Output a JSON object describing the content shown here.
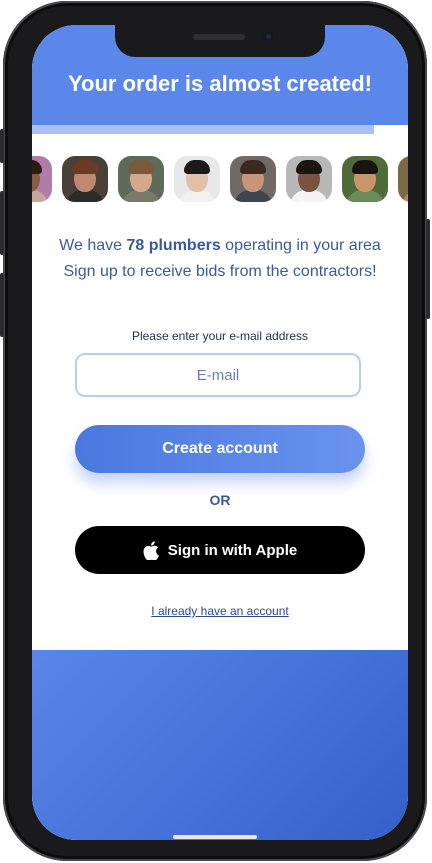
{
  "header": {
    "title": "Your order is almost created!"
  },
  "progress": {
    "fraction": 0.91
  },
  "contractors": [
    {
      "skin": "#8b5a42",
      "hair": "#2a1a12",
      "shirt": "#c7a79a",
      "bg": "#b07ca8"
    },
    {
      "skin": "#c08870",
      "hair": "#6a3a22",
      "shirt": "#2b2b2b",
      "bg": "#4a4038"
    },
    {
      "skin": "#d4a88c",
      "hair": "#7a5a3a",
      "shirt": "#7a7a6a",
      "bg": "#5f6a5a"
    },
    {
      "skin": "#e2c0a8",
      "hair": "#1a1a1a",
      "shirt": "#f0f0f0",
      "bg": "#e8e8e8"
    },
    {
      "skin": "#c99478",
      "hair": "#3a2a1e",
      "shirt": "#3f4550",
      "bg": "#6f6a66"
    },
    {
      "skin": "#7a5240",
      "hair": "#1c1410",
      "shirt": "#f4f4f4",
      "bg": "#b8b8b8"
    },
    {
      "skin": "#c9946a",
      "hair": "#1a1410",
      "shirt": "#6a8a5a",
      "bg": "#4f6b3a"
    },
    {
      "skin": "#c09070",
      "hair": "#3a2a1a",
      "shirt": "#b08a5a",
      "bg": "#7a6a4a"
    }
  ],
  "info": {
    "line1_prefix": "We have ",
    "line1_count": "78 plumbers",
    "line1_suffix": " operating in your area",
    "line2": "Sign up to receive bids from the contractors!"
  },
  "form": {
    "prompt": "Please enter your e-mail address",
    "email_placeholder": "E-mail",
    "create_label": "Create account",
    "or_label": "OR",
    "apple_label": "Sign in with Apple",
    "login_link": "I already have an account"
  },
  "colors": {
    "accent": "#5b87ea",
    "text": "#3b5a9c",
    "apple": "#000000"
  },
  "icons": {
    "apple": "apple-logo-icon"
  }
}
